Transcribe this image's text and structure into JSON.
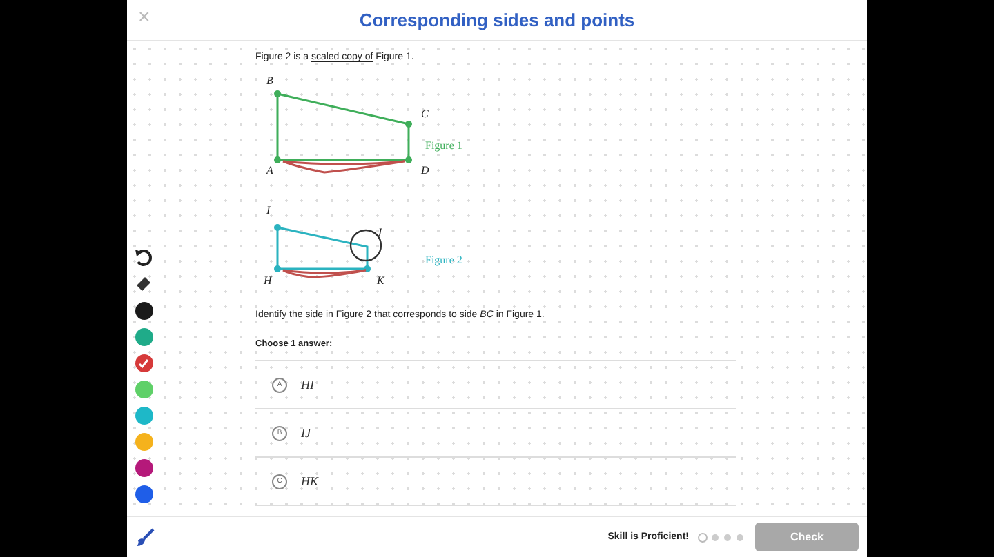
{
  "header": {
    "close": "×",
    "title": "Corresponding sides and points"
  },
  "intro": {
    "before": "Figure 2 is a ",
    "link": "scaled copy of",
    "after": " Figure 1."
  },
  "figure": {
    "labels1": [
      "B",
      "C",
      "A",
      "D"
    ],
    "caption1": "Figure 1",
    "labels2": [
      "I",
      "J",
      "H",
      "K"
    ],
    "caption2": "Figure 2"
  },
  "question": "Identify the side in Figure 2 that corresponds to side *BC* in Figure 1.",
  "prompt": "Choose 1 answer:",
  "choices": [
    {
      "letter": "A",
      "text": "HI",
      "selected": false
    },
    {
      "letter": "B",
      "text": "IJ",
      "selected": false
    },
    {
      "letter": "C",
      "text": "HK",
      "selected": false
    }
  ],
  "palette": [
    {
      "color": "#1a1a1a",
      "selected": false
    },
    {
      "color": "#1fab89",
      "selected": false
    },
    {
      "color": "#d63a3a",
      "selected": true
    },
    {
      "color": "#5fd068",
      "selected": false
    },
    {
      "color": "#1eb8c8",
      "selected": false
    },
    {
      "color": "#f5b21c",
      "selected": false
    },
    {
      "color": "#b5197a",
      "selected": false
    },
    {
      "color": "#1f5ee8",
      "selected": false
    }
  ],
  "footer": {
    "status": "Skill is Proficient!",
    "check": {
      "label": "Check",
      "disabled": true
    }
  }
}
